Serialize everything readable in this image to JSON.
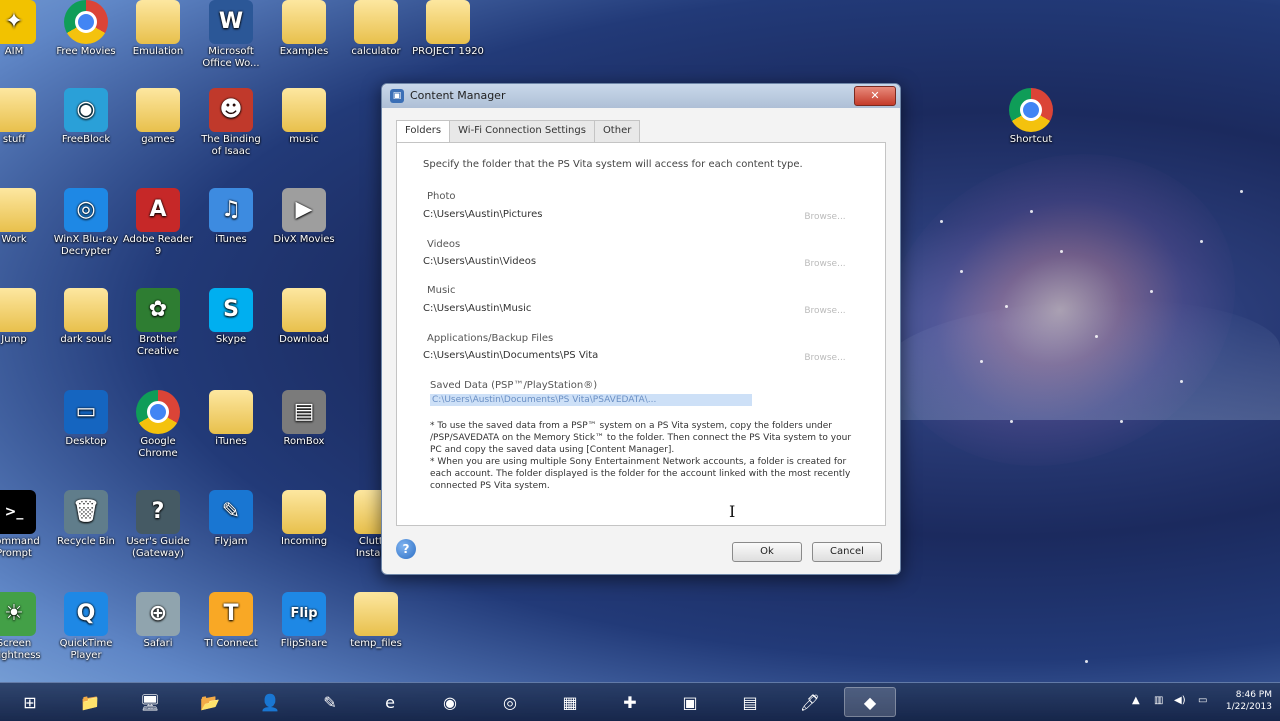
{
  "desktop_icons": [
    {
      "label": "AIM",
      "kind": "app",
      "color": "#f2c200",
      "glyph": "✦"
    },
    {
      "label": "Free Movies",
      "kind": "chrome"
    },
    {
      "label": "Emulation",
      "kind": "folder"
    },
    {
      "label": "Microsoft Office Wo...",
      "kind": "doc",
      "color": "#2b5797",
      "glyph": "W"
    },
    {
      "label": "Examples",
      "kind": "folder"
    },
    {
      "label": "calculator",
      "kind": "folder"
    },
    {
      "label": "PROJECT 1920",
      "kind": "folder"
    },
    {
      "label": "stuff",
      "kind": "folder"
    },
    {
      "label": "FreeBlock",
      "kind": "app",
      "color": "#2aa0d8",
      "glyph": "◉"
    },
    {
      "label": "games",
      "kind": "folder"
    },
    {
      "label": "The Binding of Isaac",
      "kind": "app",
      "color": "#c0392b",
      "glyph": "☻"
    },
    {
      "label": "music",
      "kind": "folder"
    },
    {
      "label": "Work",
      "kind": "folder"
    },
    {
      "label": "WinX Blu-ray Decrypter",
      "kind": "app",
      "color": "#1e88e5",
      "glyph": "◎"
    },
    {
      "label": "Adobe Reader 9",
      "kind": "app",
      "color": "#c62828",
      "glyph": "A"
    },
    {
      "label": "iTunes",
      "kind": "app",
      "color": "#3d8be0",
      "glyph": "♫"
    },
    {
      "label": "DivX Movies",
      "kind": "app",
      "color": "#9e9e9e",
      "glyph": "▶"
    },
    {
      "label": "Jump",
      "kind": "folder"
    },
    {
      "label": "dark souls",
      "kind": "folder"
    },
    {
      "label": "Brother Creative",
      "kind": "app",
      "color": "#2e7d32",
      "glyph": "✿"
    },
    {
      "label": "Skype",
      "kind": "app",
      "color": "#00aff0",
      "glyph": "S"
    },
    {
      "label": "Download",
      "kind": "folder"
    },
    {
      "label": "Desktop",
      "kind": "app",
      "color": "#1565c0",
      "glyph": "▭"
    },
    {
      "label": "Google Chrome",
      "kind": "chrome"
    },
    {
      "label": "iTunes",
      "kind": "folder"
    },
    {
      "label": "RomBox",
      "kind": "app",
      "color": "#7b7b7b",
      "glyph": "▤"
    },
    {
      "label": "Command Prompt",
      "kind": "app",
      "color": "#000000",
      "glyph": ">_"
    },
    {
      "label": "Recycle Bin",
      "kind": "app",
      "color": "#607d8b",
      "glyph": "🗑"
    },
    {
      "label": "User's Guide (Gateway)",
      "kind": "app",
      "color": "#455a64",
      "glyph": "?"
    },
    {
      "label": "Flyjam",
      "kind": "app",
      "color": "#1976d2",
      "glyph": "✎"
    },
    {
      "label": "Incoming",
      "kind": "folder"
    },
    {
      "label": "Screen Brightness",
      "kind": "app",
      "color": "#43a047",
      "glyph": "☀"
    },
    {
      "label": "QuickTime Player",
      "kind": "app",
      "color": "#1e88e5",
      "glyph": "Q"
    },
    {
      "label": "Safari",
      "kind": "app",
      "color": "#90a4ae",
      "glyph": "⊕"
    },
    {
      "label": "TI Connect",
      "kind": "app",
      "color": "#f9a825",
      "glyph": "T"
    },
    {
      "label": "FlipShare",
      "kind": "app",
      "color": "#1e88e5",
      "glyph": "Flip"
    },
    {
      "label": "temp_files",
      "kind": "folder"
    },
    {
      "label": "Clutter Installer",
      "kind": "folder"
    },
    {
      "label": "Shortcut",
      "kind": "chrome"
    }
  ],
  "dialog": {
    "title": "Content Manager",
    "close_label": "✕",
    "tabs": [
      "Folders",
      "Wi-Fi Connection Settings",
      "Other"
    ],
    "intro": "Specify the folder that the PS Vita system will access for each content type.",
    "categories": [
      {
        "label": "Photo",
        "path": "C:\\Users\\Austin\\Pictures",
        "browse": "Browse..."
      },
      {
        "label": "Videos",
        "path": "C:\\Users\\Austin\\Videos",
        "browse": "Browse..."
      },
      {
        "label": "Music",
        "path": "C:\\Users\\Austin\\Music",
        "browse": "Browse..."
      },
      {
        "label": "Applications/Backup Files",
        "path": "C:\\Users\\Austin\\Documents\\PS Vita",
        "browse": "Browse..."
      }
    ],
    "saved": {
      "label": "Saved Data (PSP™/PlayStation®)",
      "path": "C:\\Users\\Austin\\Documents\\PS Vita\\PSAVEDATA\\...",
      "note1": "* To use the saved data from a PSP™ system on a PS Vita system, copy the folders under /PSP/SAVEDATA on the Memory Stick™ to the folder. Then connect the PS Vita system to your PC and copy the saved data using [Content Manager].",
      "note2": "* When you are using multiple Sony Entertainment Network accounts, a folder is created for each account. The folder displayed is the folder for the account linked with the most recently connected PS Vita system."
    },
    "ok_label": "Ok",
    "cancel_label": "Cancel",
    "help_label": "?"
  },
  "taskbar": {
    "items": [
      "⊞",
      "📁",
      "🖥",
      "📂",
      "👤",
      "✎",
      "e",
      "◉",
      "◎",
      "▦",
      "✚",
      "▣",
      "▤",
      "🖊",
      "◆"
    ],
    "active_index": 14,
    "time": "8:46 PM",
    "date": "1/22/2013"
  }
}
